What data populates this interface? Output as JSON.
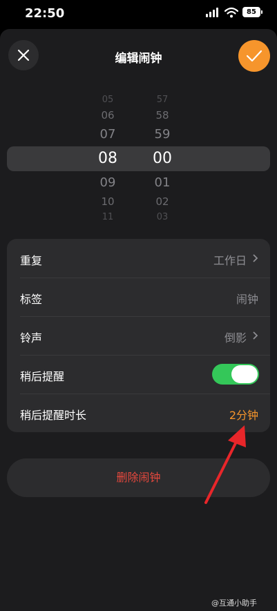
{
  "status_bar": {
    "time": "22:50",
    "battery": "85"
  },
  "header": {
    "title": "编辑闹钟",
    "close_icon": "close-icon",
    "confirm_icon": "checkmark-icon"
  },
  "colors": {
    "accent": "#f6952c",
    "toggle_on": "#34c759",
    "destructive": "#e5483d"
  },
  "time_picker": {
    "hours": [
      "05",
      "06",
      "07",
      "08",
      "09",
      "10",
      "11"
    ],
    "minutes": [
      "57",
      "58",
      "59",
      "00",
      "01",
      "02",
      "03"
    ],
    "selected_hour": "08",
    "selected_minute": "00"
  },
  "settings": {
    "repeat": {
      "label": "重复",
      "value": "工作日"
    },
    "tag": {
      "label": "标签",
      "placeholder": "闹钟"
    },
    "ringtone": {
      "label": "铃声",
      "value": "倒影"
    },
    "snooze": {
      "label": "稍后提醒",
      "enabled": true
    },
    "snooze_duration": {
      "label": "稍后提醒时长",
      "value": "2分钟"
    }
  },
  "delete_label": "删除闹钟",
  "watermark": "@互通小助手"
}
